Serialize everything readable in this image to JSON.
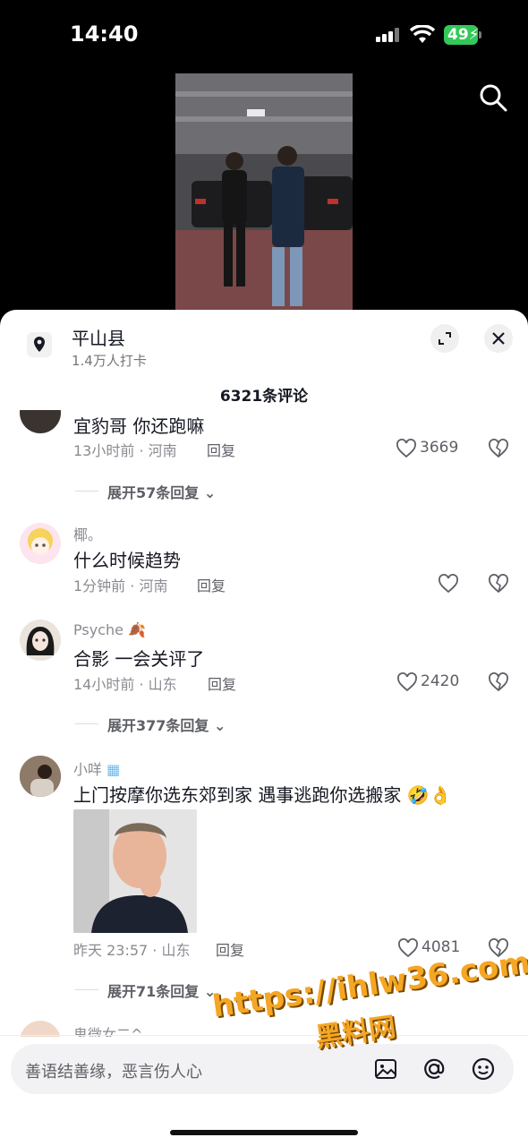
{
  "status": {
    "time": "14:40",
    "battery": "49"
  },
  "location": {
    "name": "平山县",
    "checkins": "1.4万人打卡"
  },
  "comments_count": "6321条评论",
  "comments": [
    {
      "text": "宜豹哥 你还跑嘛",
      "meta": "13小时前 · 河南",
      "reply": "回复",
      "likes": "3669",
      "expand": "展开57条回复"
    },
    {
      "user": "椰。",
      "text": "什么时候趋势",
      "meta": "1分钟前 · 河南",
      "reply": "回复",
      "likes": ""
    },
    {
      "user": "Psyche",
      "text": "合影 一会关评了",
      "meta": "14小时前 · 山东",
      "reply": "回复",
      "likes": "2420",
      "expand": "展开377条回复"
    },
    {
      "user": "小咩",
      "text": "上门按摩你选东郊到家 遇事逃跑你选搬家",
      "meta": "昨天 23:57 · 山东",
      "reply": "回复",
      "likes": "4081",
      "expand": "展开71条回复"
    },
    {
      "user": "鬼微女二^"
    }
  ],
  "input": {
    "placeholder": "善语结善缘，恶言伤人心"
  },
  "watermark": {
    "line1": "https://ihlw36.com",
    "line2": "黑料网"
  },
  "colors": {
    "battery": "#34c759",
    "text": "#161823",
    "meta": "#8a8b91"
  },
  "icons": [
    "search-icon",
    "location-pin-icon",
    "expand-icon",
    "close-icon",
    "heart-icon",
    "dislike-icon",
    "image-icon",
    "at-icon",
    "emoji-icon"
  ]
}
